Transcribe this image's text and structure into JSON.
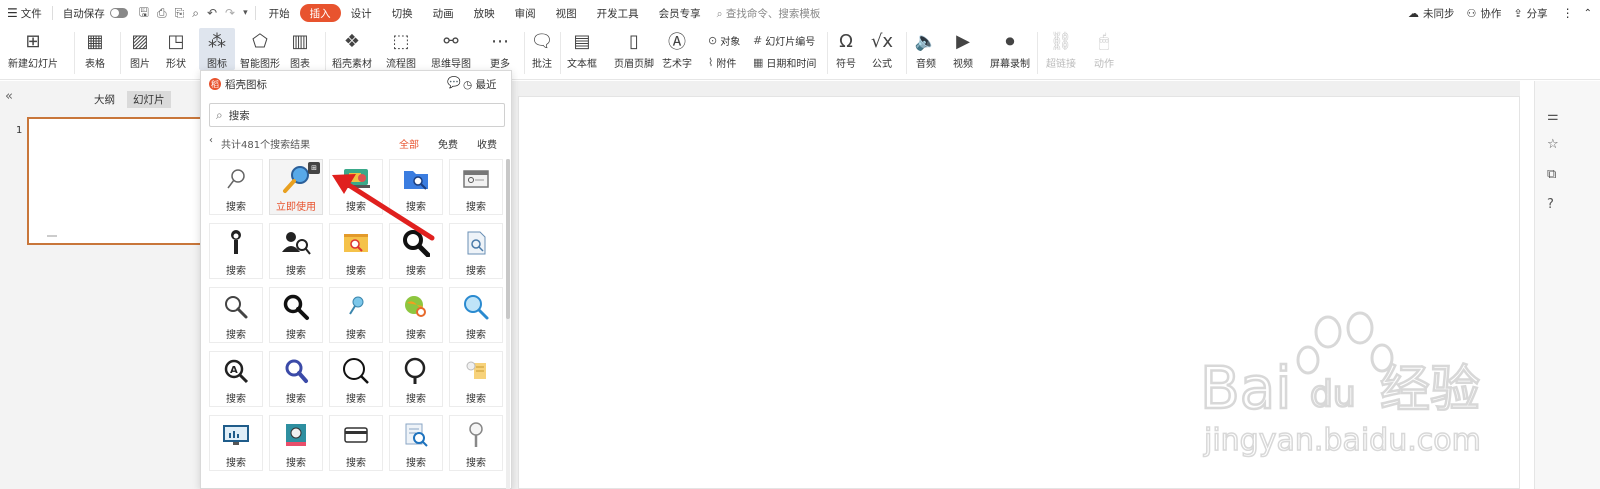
{
  "menubar": {
    "menu_icon": "hamburger-icon",
    "file_label": "文件",
    "autosave_label": "自动保存",
    "tabs": [
      {
        "label": "开始"
      },
      {
        "label": "插入",
        "active": true
      },
      {
        "label": "设计"
      },
      {
        "label": "切换"
      },
      {
        "label": "动画"
      },
      {
        "label": "放映"
      },
      {
        "label": "审阅"
      },
      {
        "label": "视图"
      },
      {
        "label": "开发工具"
      },
      {
        "label": "会员专享"
      }
    ],
    "search_placeholder": "查找命令、搜索模板",
    "sync_label": "未同步",
    "collab_label": "协作",
    "share_label": "分享"
  },
  "ribbon": {
    "new_slide": "新建幻灯片",
    "table": "表格",
    "picture": "图片",
    "shape": "形状",
    "icon": "图标",
    "smartart": "智能图形",
    "chart": "图表",
    "material": "稻壳素材",
    "flowchart": "流程图",
    "mindmap": "思维导图",
    "more": "更多",
    "comment": "批注",
    "textbox": "文本框",
    "header_footer": "页眉页脚",
    "wordart": "艺术字",
    "object": "对象",
    "attachment": "附件",
    "slide_number": "幻灯片编号",
    "datetime": "日期和时间",
    "symbol": "符号",
    "formula": "公式",
    "audio": "音频",
    "video": "视频",
    "screen_record": "屏幕录制",
    "hyperlink": "超链接",
    "action": "动作"
  },
  "left_pane": {
    "outline_tab": "大纲",
    "slides_tab": "幻灯片",
    "slide_number": "1"
  },
  "icon_panel": {
    "title": "稻壳图标",
    "recent": "最近",
    "search_value": "搜索",
    "result_count": "共计481个搜索结果",
    "filters": [
      "全部",
      "免费",
      "收费"
    ],
    "active_filter": "全部",
    "use_now": "立即使用",
    "item_label": "搜索",
    "items": [
      {
        "label": "搜索",
        "icon": "pin-search-icon"
      },
      {
        "label": "立即使用",
        "icon": "magnifier-color-icon",
        "hover": true
      },
      {
        "label": "搜索",
        "icon": "laptop-folder-icon"
      },
      {
        "label": "搜索",
        "icon": "folder-search-icon"
      },
      {
        "label": "搜索",
        "icon": "browser-window-icon"
      },
      {
        "label": "搜索",
        "icon": "person-magnifier-icon"
      },
      {
        "label": "搜索",
        "icon": "users-search-icon"
      },
      {
        "label": "搜索",
        "icon": "web-search-icon"
      },
      {
        "label": "搜索",
        "icon": "bold-magnifier-icon"
      },
      {
        "label": "搜索",
        "icon": "document-search-icon"
      },
      {
        "label": "搜索",
        "icon": "outline-magnifier-icon"
      },
      {
        "label": "搜索",
        "icon": "black-magnifier-icon"
      },
      {
        "label": "搜索",
        "icon": "small-pin-icon"
      },
      {
        "label": "搜索",
        "icon": "globe-search-icon"
      },
      {
        "label": "搜索",
        "icon": "blue-magnifier-icon"
      },
      {
        "label": "搜索",
        "icon": "letter-a-search-icon"
      },
      {
        "label": "搜索",
        "icon": "purple-magnifier-icon"
      },
      {
        "label": "搜索",
        "icon": "thin-magnifier-icon"
      },
      {
        "label": "搜索",
        "icon": "round-magnifier-icon"
      },
      {
        "label": "搜索",
        "icon": "notes-search-icon"
      },
      {
        "label": "搜索",
        "icon": "monitor-chart-icon"
      },
      {
        "label": "搜索",
        "icon": "book-search-icon"
      },
      {
        "label": "搜索",
        "icon": "card-icon"
      },
      {
        "label": "搜索",
        "icon": "list-search-icon"
      },
      {
        "label": "搜索",
        "icon": "tall-magnifier-icon"
      }
    ]
  },
  "watermark": {
    "brand": "Bai",
    "brand2": "du",
    "brand_cn": "经验",
    "url": "jingyan.baidu.com"
  },
  "colors": {
    "accent": "#e8532e",
    "thumb_border": "#c8763a",
    "arrow": "#e0201e"
  }
}
